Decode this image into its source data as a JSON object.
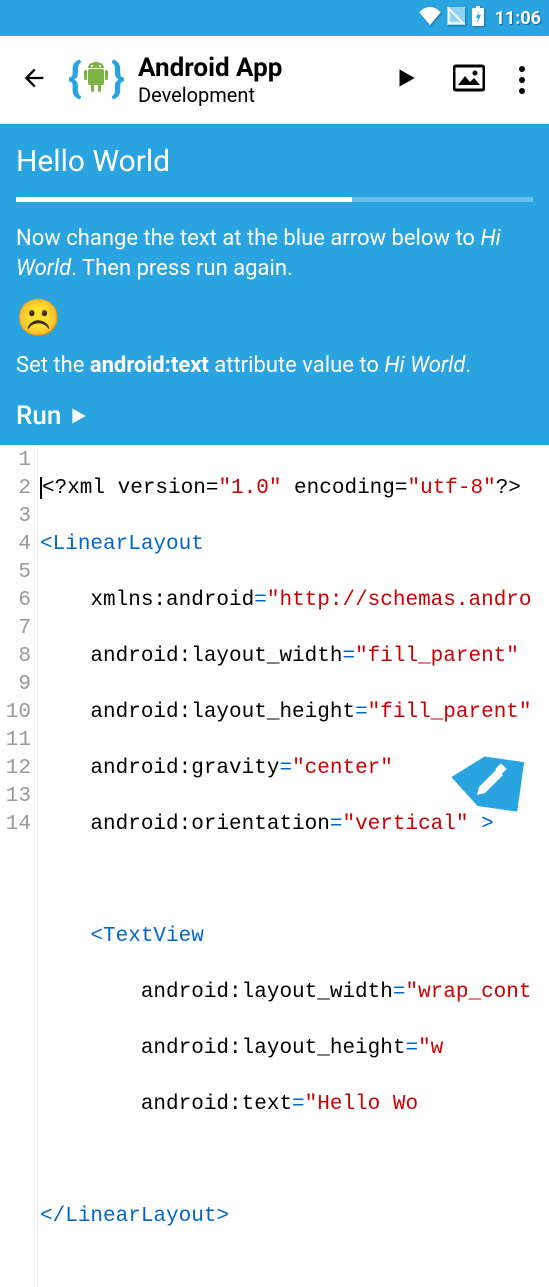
{
  "status": {
    "time": "11:06"
  },
  "toolbar": {
    "title": "Android App",
    "subtitle": "Development"
  },
  "lesson": {
    "title": "Hello World",
    "progress_pct": 65,
    "line1a": "Now change the text at the blue arrow below to ",
    "line1b": "Hi World",
    "line1c": ". Then press run again.",
    "line2a": "Set the ",
    "line2b": "android:text",
    "line2c": " attribute value to ",
    "line2d": "Hi World",
    "line2e": ".",
    "run_label": "Run"
  },
  "code": {
    "line_count": 14,
    "l1_a": "<?xml version=",
    "l1_b": "\"1.0\"",
    "l1_c": " encoding=",
    "l1_d": "\"utf-8\"",
    "l1_e": "?>",
    "l2_a": "<",
    "l2_b": "LinearLayout",
    "l3_a": "    xmlns:android",
    "l3_b": "=",
    "l3_c": "\"http://schemas.andro",
    "l4_a": "    android:layout_width",
    "l4_b": "=",
    "l4_c": "\"fill_parent\"",
    "l5_a": "    android:layout_height",
    "l5_b": "=",
    "l5_c": "\"fill_parent\"",
    "l6_a": "    android:gravity",
    "l6_b": "=",
    "l6_c": "\"center\"",
    "l7_a": "    android:orientation",
    "l7_b": "=",
    "l7_c": "\"vertical\"",
    "l7_d": " >",
    "l9_a": "    <",
    "l9_b": "TextView",
    "l10_a": "        android:layout_width",
    "l10_b": "=",
    "l10_c": "\"wrap_cont",
    "l11_a": "        android:layout_height",
    "l11_b": "=",
    "l11_c": "\"w",
    "l12_a": "        android:text",
    "l12_b": "=",
    "l12_c": "\"Hello Wo",
    "l14_a": "</",
    "l14_b": "LinearLayout",
    "l14_c": ">"
  }
}
